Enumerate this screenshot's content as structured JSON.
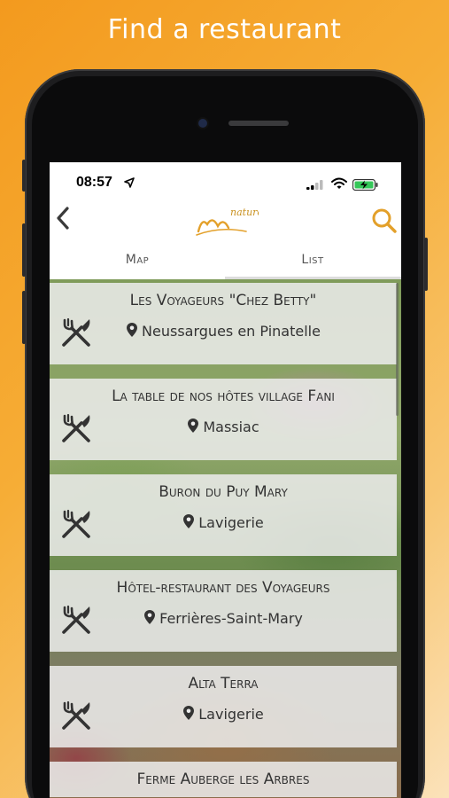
{
  "hero": {
    "title": "Find a restaurant"
  },
  "status_bar": {
    "time": "08:57"
  },
  "nav": {
    "logo_text": "nature"
  },
  "tabs": [
    {
      "label": "Map",
      "selected": false
    },
    {
      "label": "List",
      "selected": true
    }
  ],
  "restaurants": [
    {
      "name": "Les Voyageurs \"Chez Betty\"",
      "location": "Neussargues en Pinatelle"
    },
    {
      "name": "La table de nos hôtes village Fani",
      "location": "Massiac"
    },
    {
      "name": "Buron du Puy Mary",
      "location": "Lavigerie"
    },
    {
      "name": "Hôtel-restaurant des Voyageurs",
      "location": "Ferrières-Saint-Mary"
    },
    {
      "name": "Alta Terra",
      "location": "Lavigerie"
    },
    {
      "name": "Ferme Auberge les Arbres",
      "location": ""
    }
  ],
  "colors": {
    "accent": "#e3a02a",
    "background_orange": "#f39a1e"
  }
}
